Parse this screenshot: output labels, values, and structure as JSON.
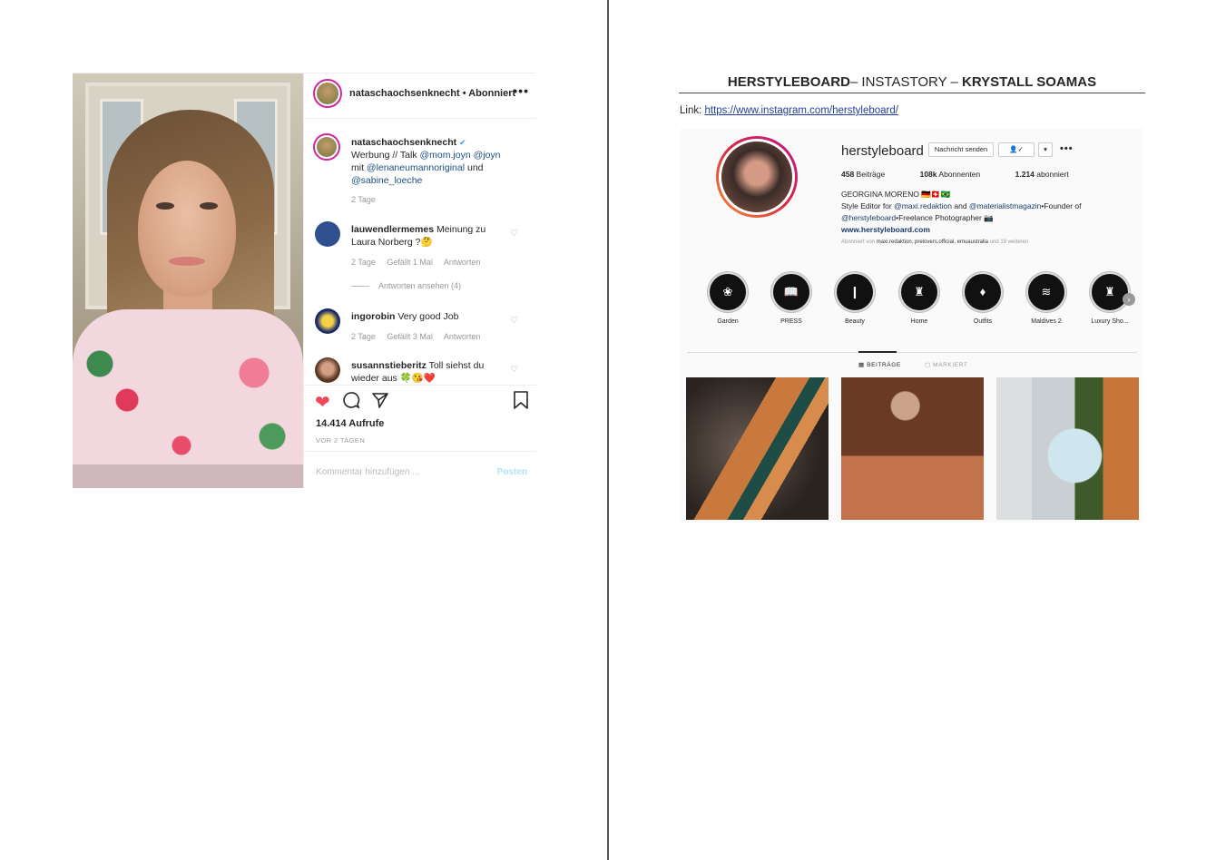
{
  "post": {
    "header_username": "nataschaochsenknecht",
    "header_status": "• Abonniert",
    "more": "•••",
    "caption": {
      "username": "nataschaochsenknecht",
      "verified": "✔",
      "text_1": "Werbung // Talk ",
      "mention_1": "@mom.joyn",
      "mention_2": "@joyn",
      "text_2": " mit ",
      "mention_3": "@lenaneumannoriginal",
      "text_3": " und ",
      "mention_4": "@sabine_loeche",
      "time": "2 Tage"
    },
    "comments": [
      {
        "username": "lauwendlermemes",
        "text": "Meinung zu Laura Norberg ?🤔",
        "time": "2 Tage",
        "likes": "Gefällt 1 Mal",
        "reply": "Antworten",
        "view_replies": "Antworten ansehen (4)"
      },
      {
        "username": "ingorobin",
        "text": "Very good Job",
        "time": "2 Tage",
        "likes": "Gefällt 3 Mal",
        "reply": "Antworten"
      },
      {
        "username": "susannstieberitz",
        "text": "Toll siehst du wieder aus 🍀😘❤️"
      }
    ],
    "views": "14.414 Aufrufe",
    "ago": "VOR 2 TAGEN",
    "add_comment_placeholder": "Kommentar hinzufügen ...",
    "post_button": "Posten",
    "icons": [
      "heart-icon",
      "comment-icon",
      "share-icon",
      "bookmark-icon"
    ]
  },
  "doc": {
    "title_bold_1": "HERSTYLEBOARD",
    "title_mid": "– INSTASTORY – ",
    "title_bold_2": "KRYSTALL SOAMAS",
    "link_label": "Link: ",
    "link_url": "https://www.instagram.com/herstyleboard/"
  },
  "profile": {
    "username": "herstyleboard",
    "message_button": "Nachricht senden",
    "follow_button": "👤✓",
    "dropdown": "▾",
    "more": "•••",
    "stats": {
      "posts_num": "458",
      "posts_label": " Beiträge",
      "followers_num": "108k",
      "followers_label": " Abonnenten",
      "following_num": "1.214",
      "following_label": " abonniert"
    },
    "bio_name": "GEORGINA MORENO 🇩🇪🇨🇭🇧🇷",
    "bio_line_1a": "Style Editor for ",
    "bio_mention_1": "@maxi.redaktion",
    "bio_line_1b": " and ",
    "bio_mention_2": "@materialistmagazin",
    "bio_line_1c": "•Founder of",
    "bio_mention_3": "@herstyleboard",
    "bio_line_2": "•Freelance Photographer 📷",
    "website": "www.herstyleboard.com",
    "followed_prefix": "Abonniert von ",
    "followed_names": "maxi.redaktion, prelovers.official, emuaustralia",
    "followed_suffix": " und 19 weiteren",
    "highlights": [
      {
        "label": "Garden",
        "icon": "❀"
      },
      {
        "label": "PRESS",
        "icon": "📖"
      },
      {
        "label": "Beauty",
        "icon": "❙"
      },
      {
        "label": "Home",
        "icon": "♜"
      },
      {
        "label": "Outfits",
        "icon": "♦"
      },
      {
        "label": "Maldives 2",
        "icon": "≋"
      },
      {
        "label": "Luxury Sho...",
        "icon": "♜"
      }
    ],
    "tab_posts": "▦ BEITRÄGE",
    "tab_tagged": "▢ MARKIERT"
  }
}
